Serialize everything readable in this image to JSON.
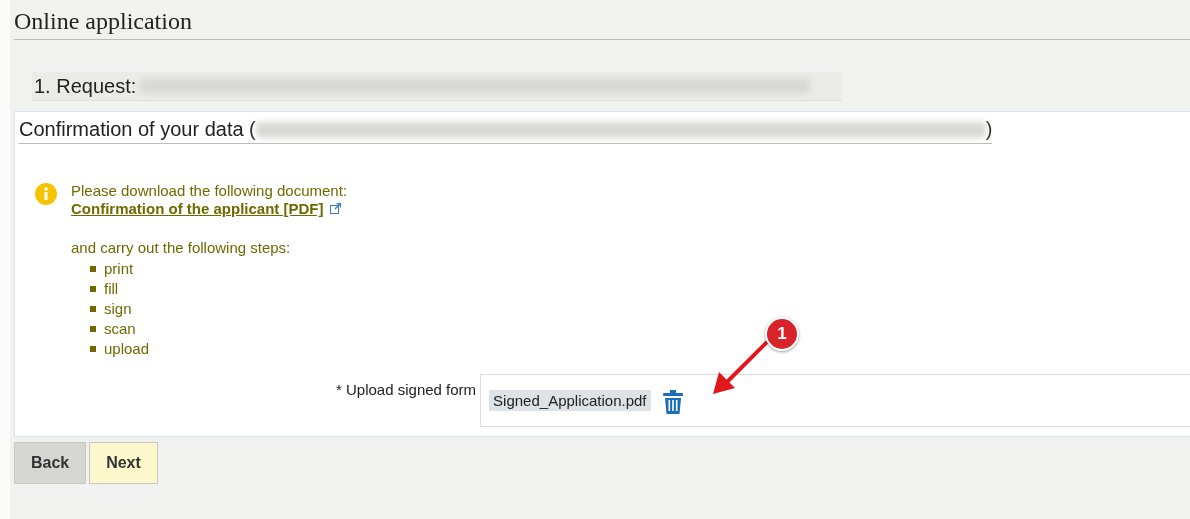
{
  "page_title": "Online application",
  "request": {
    "label": "1. Request:"
  },
  "section": {
    "title_prefix": "Confirmation of your data (",
    "title_suffix": ")"
  },
  "info": {
    "intro": "Please download the following document:",
    "link": "Confirmation of the applicant [PDF]",
    "steps_intro": "and carry out the following steps:",
    "steps": [
      "print",
      "fill",
      "sign",
      "scan",
      "upload"
    ]
  },
  "upload": {
    "label": "* Upload signed form",
    "file": "Signed_Application.pdf"
  },
  "annotation": {
    "label": "1"
  },
  "buttons": [
    {
      "label": "Back",
      "kind": "secondary"
    },
    {
      "label": "Next",
      "kind": "primary"
    }
  ]
}
